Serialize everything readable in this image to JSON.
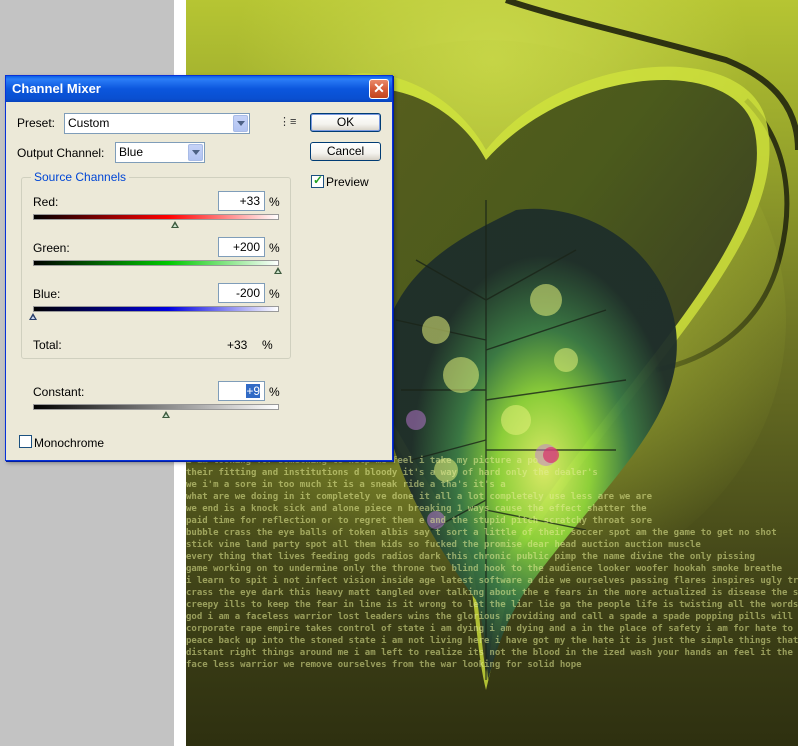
{
  "dialog": {
    "title": "Channel Mixer",
    "close_glyph": "✕",
    "preset_label": "Preset:",
    "preset_value": "Custom",
    "output_channel_label": "Output Channel:",
    "output_channel_value": "Blue",
    "ok_label": "OK",
    "cancel_label": "Cancel",
    "preview_label": "Preview",
    "preview_checked": true,
    "source_channels_label": "Source Channels",
    "channels": [
      {
        "label": "Red:",
        "value": "+33",
        "unit": "%",
        "level": 0.583
      },
      {
        "label": "Green:",
        "value": "+200",
        "unit": "%",
        "level": 1.0
      },
      {
        "label": "Blue:",
        "value": "-200",
        "unit": "%",
        "level": 0.0
      }
    ],
    "total_label": "Total:",
    "total_value": "+33",
    "total_unit": "%",
    "constant_label": "Constant:",
    "constant_value": "+9",
    "constant_unit": "%",
    "constant_level": 0.545,
    "monochrome_label": "Monochrome",
    "monochrome_checked": false
  },
  "canvas": {
    "text_lines": [
      "i am looking for something to help me feel i take my picture a po",
      "their fitting and institutions                    d bloody it's a way of hard only the dealer's",
      "we i'm a sore in too much                         it is a sneak ride a tha's it's a",
      "what are we doing in it completely              ve done it all a lot completely use less are we are",
      "we end is a knock sick and alone piece           n breaking 1 ways cause the effect shatter the",
      "paid time for reflection or to regret them       e and the stupid pitch scratchy throat sore",
      "bubble crass the eye balls of token albis say    t sort a little of their soccer spot am the game to get no shot",
      "stick vine land party spot all them kids so fucked   the promise dear head auction auction muscle",
      "every thing that lives feeding gods radios dark this     chronic public pimp the name divine the only pissing",
      "game working on to undermine only the throne two blind hook    to the audience looker woofer hookah smoke breathe",
      "i learn to spit i not infect vision inside age latest software a   die we ourselves passing flares inspires ugly traits sanitize",
      "crass the eye dark this heavy matt tangled over talking about the    e fears in the more actualized is disease the souls state i am a",
      "creepy ills to keep the fear in line is it wrong to let the liar lie ga   the people life is twisting all the words to shun life worth less than",
      "god i am a faceless warrior lost leaders wins the glorious providing   and call a spade a spade popping pills will ease the daily pain bon biory",
      "corporate rape empire takes control of  state i am dying i am dying and a   in the place of safety i am  for hate to be a vie with all these",
      "peace back up into the stoned state i am not living here i have got my    the hate it is just the simple things that i relish i am a god i am a",
      "distant right things around me i am left to realize its not the blood in the   ized wash your hands an feel it the dirt is down the drain. enough",
      "face less warrior we remove ourselves from the war looking for solid hope"
    ]
  }
}
